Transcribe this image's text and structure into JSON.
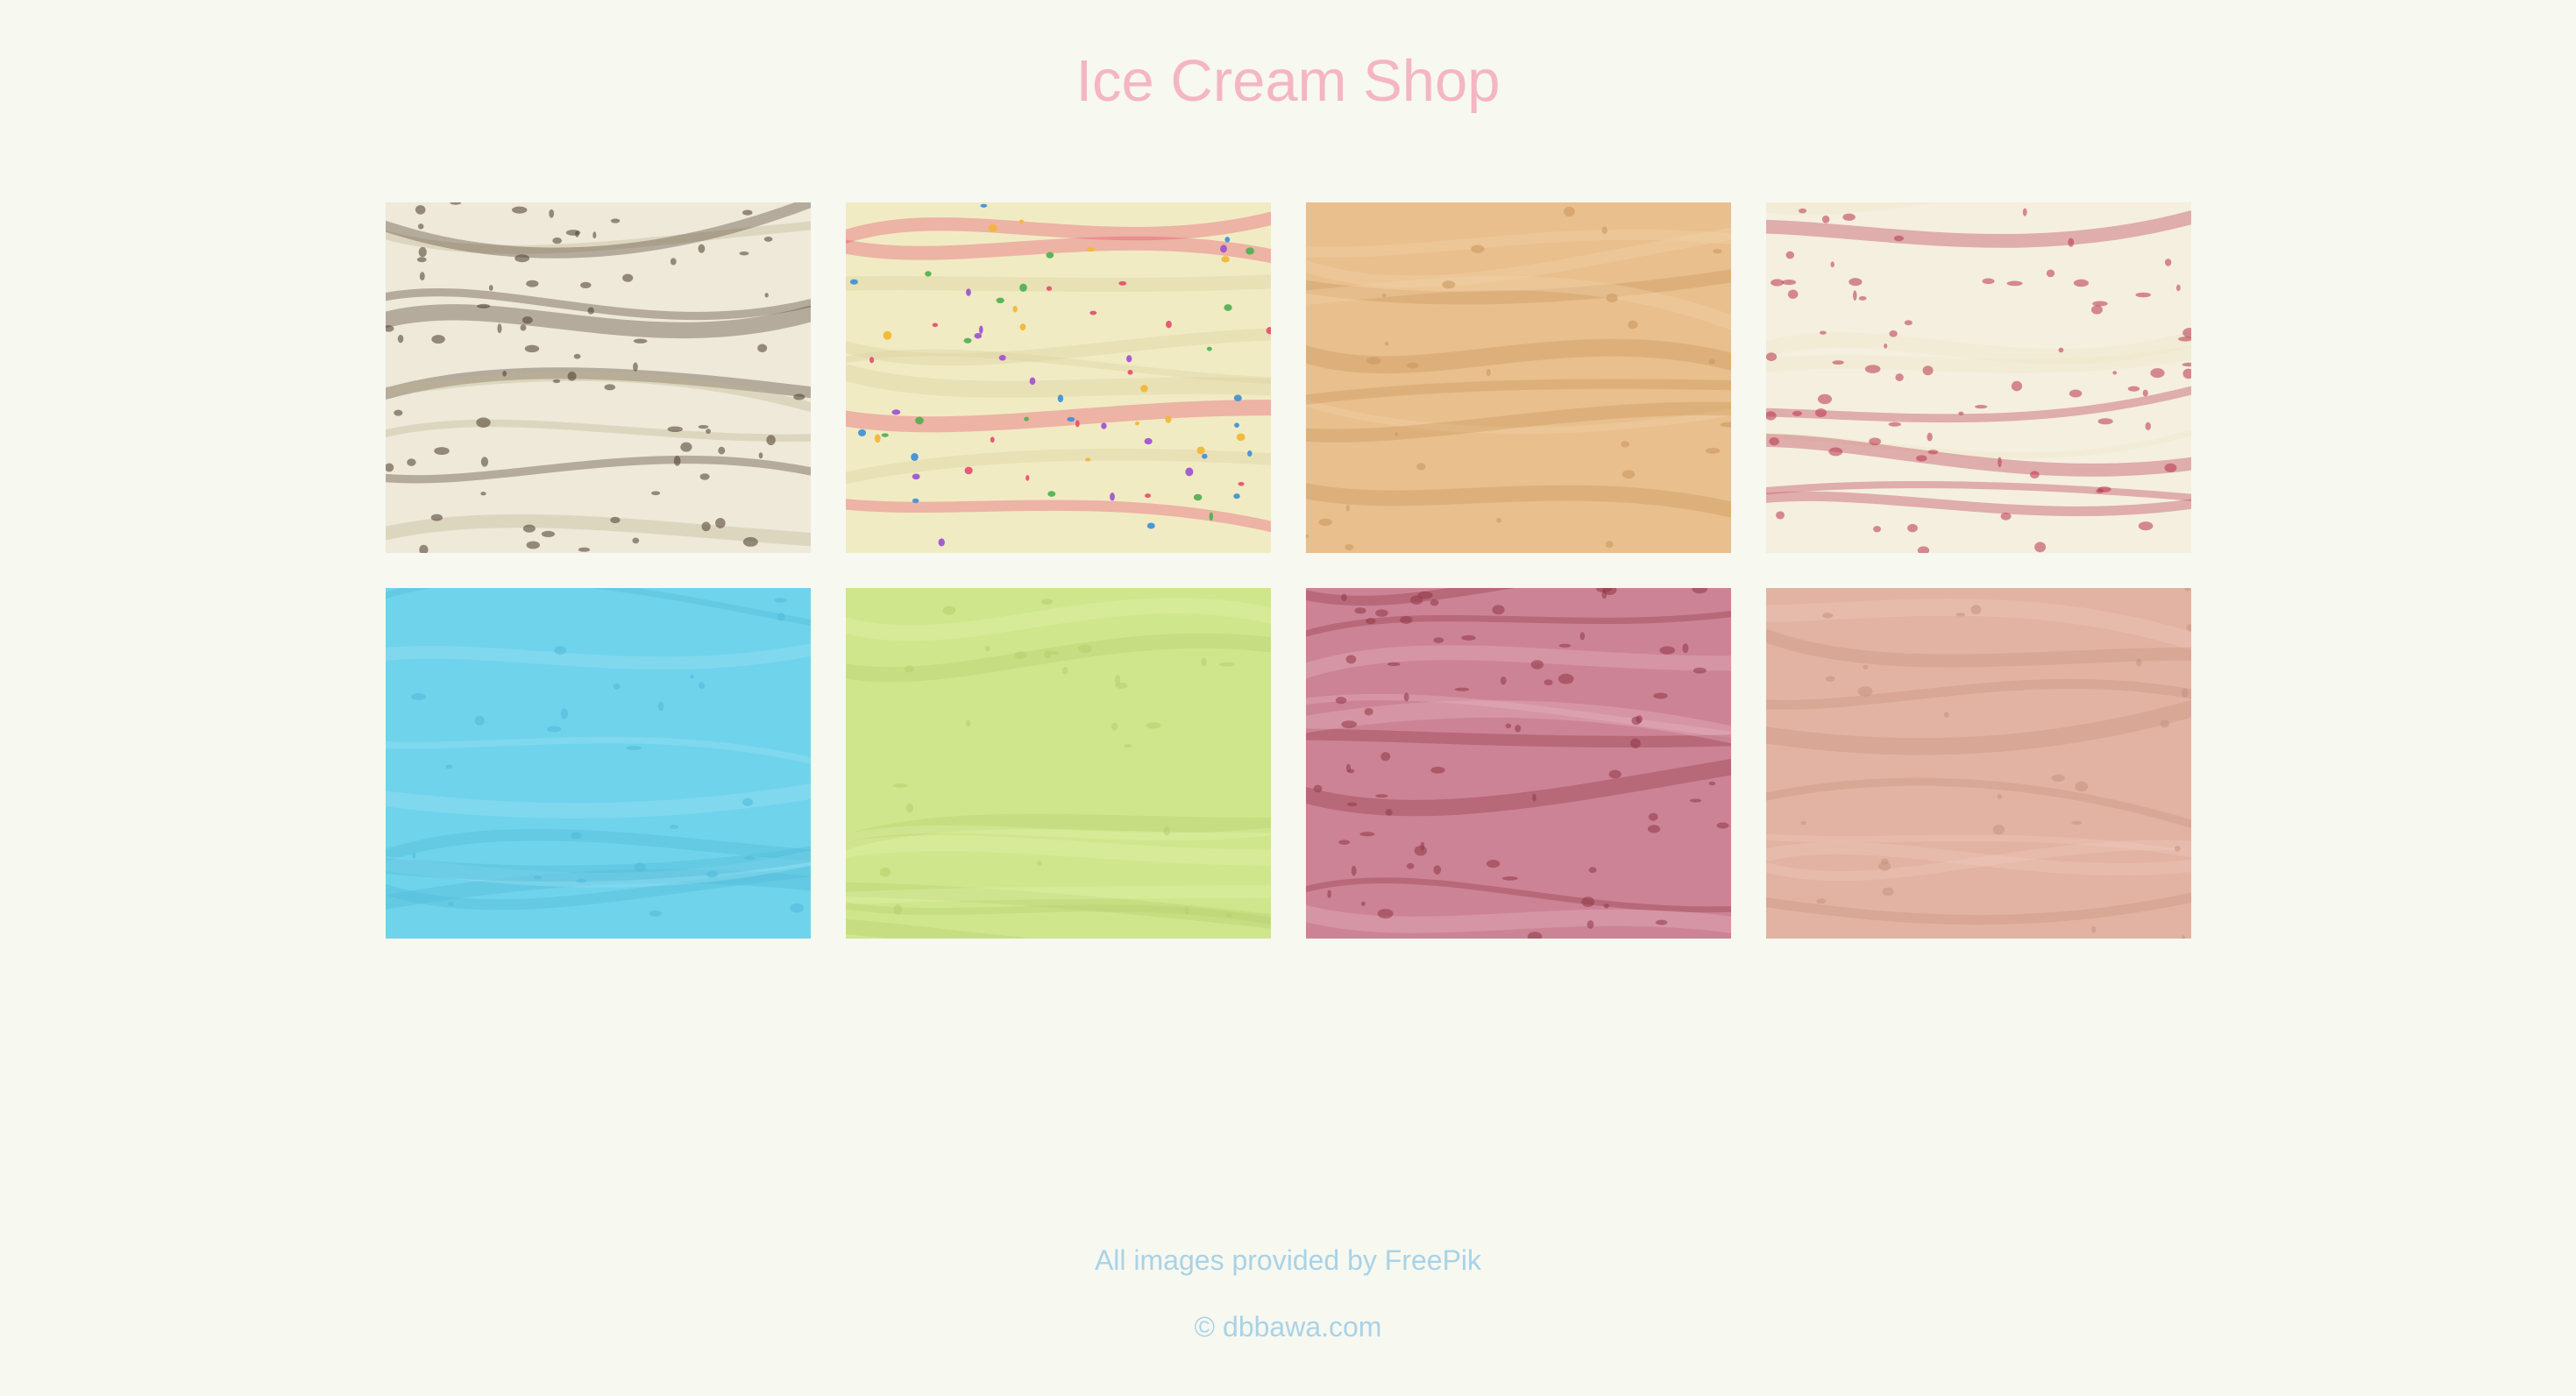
{
  "page": {
    "title": "Ice Cream Shop",
    "title_color": "#f4b6c2",
    "background": "#f7f8f0"
  },
  "gallery": {
    "tiles": [
      {
        "name": "chocolate-chip-ice-cream",
        "base": "#eee9d9",
        "accent": "#4a3a2a",
        "accent2": "#bdb58f"
      },
      {
        "name": "vanilla-sprinkles-ice-cream",
        "base": "#f1ebc4",
        "accent": "#d9cf9f",
        "accent2": "#e54b6b"
      },
      {
        "name": "caramel-ice-cream",
        "base": "#e8bf8d",
        "accent": "#c9955b",
        "accent2": "#f3d5a8"
      },
      {
        "name": "strawberry-swirl-ice-cream",
        "base": "#f5efdf",
        "accent": "#b8334a",
        "accent2": "#efe6c6"
      },
      {
        "name": "blue-ice-cream",
        "base": "#6fd3ec",
        "accent": "#4fb9d8",
        "accent2": "#9fe3f3"
      },
      {
        "name": "green-ice-cream",
        "base": "#cfe68d",
        "accent": "#b4cf6c",
        "accent2": "#e1f0ad"
      },
      {
        "name": "berry-ice-cream",
        "base": "#cd8396",
        "accent": "#8f3645",
        "accent2": "#e7b6c2"
      },
      {
        "name": "chocolate-ice-cream",
        "base": "#e2b3a3",
        "accent": "#c5917f",
        "accent2": "#f0ccbe"
      }
    ]
  },
  "footer": {
    "credit_prefix": "All images provided by ",
    "credit_link": "FreePik",
    "copyright": "© dbbawa.com",
    "color": "#a9d3e6"
  }
}
